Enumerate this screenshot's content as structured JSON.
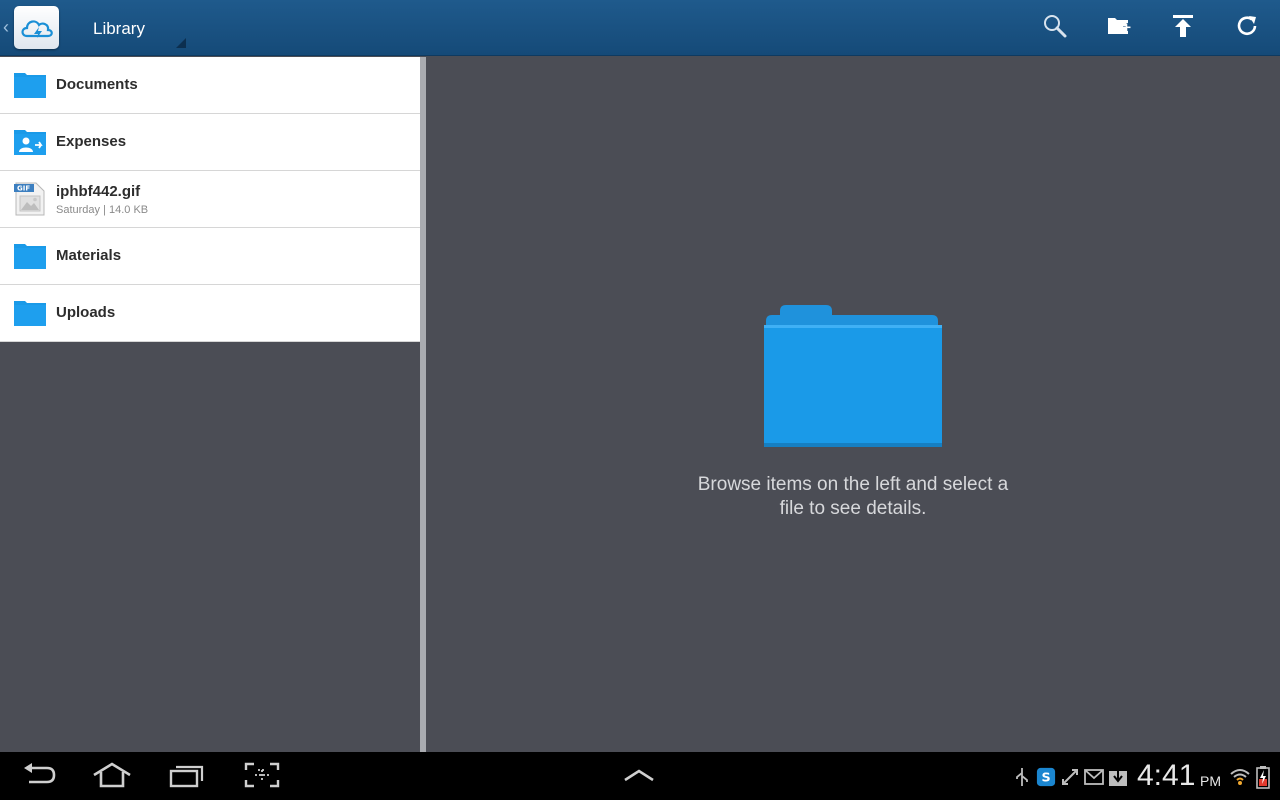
{
  "actionbar": {
    "title": "Library",
    "back_icon": "chevron-left-icon",
    "app_icon": "cloud-sync-icon",
    "actions": [
      {
        "name": "search-icon"
      },
      {
        "name": "new-folder-icon"
      },
      {
        "name": "upload-icon"
      },
      {
        "name": "refresh-icon"
      }
    ]
  },
  "list": {
    "items": [
      {
        "name": "Documents",
        "type": "folder"
      },
      {
        "name": "Expenses",
        "type": "shared-folder"
      },
      {
        "name": "iphbf442.gif",
        "type": "file",
        "meta": "Saturday | 14.0 KB",
        "badge": "GIF"
      },
      {
        "name": "Materials",
        "type": "folder"
      },
      {
        "name": "Uploads",
        "type": "folder"
      }
    ]
  },
  "detail": {
    "empty_message_line1": "Browse items on the left and select a",
    "empty_message_line2": "file to see details.",
    "folder_icon": "folder-icon"
  },
  "system_bar": {
    "time": "4:41",
    "ampm": "PM",
    "nav_icons": [
      "back-icon",
      "home-icon",
      "recent-apps-icon",
      "screenshot-icon",
      "chevron-up-icon"
    ],
    "status_icons": [
      "usb-icon",
      "skype-icon",
      "sync-icon",
      "gmail-icon",
      "download-icon",
      "wifi-icon",
      "battery-icon"
    ]
  },
  "colors": {
    "actionbar": "#1a5283",
    "folder_blue": "#1a9ae8",
    "pane_background": "#4b4d55",
    "list_background": "#ffffff"
  }
}
